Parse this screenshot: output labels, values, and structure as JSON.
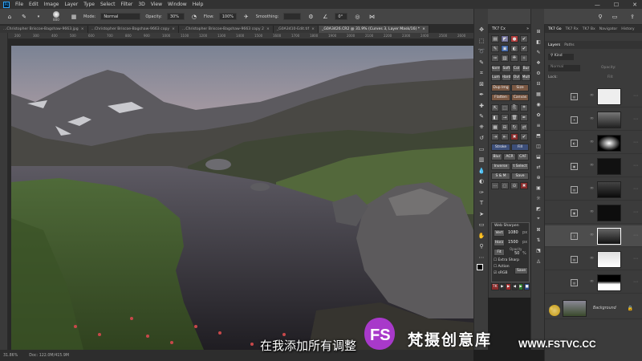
{
  "menubar": {
    "app_icon": "Ps",
    "items": [
      "File",
      "Edit",
      "Image",
      "Layer",
      "Type",
      "Select",
      "Filter",
      "3D",
      "View",
      "Window",
      "Help"
    ],
    "window_controls": [
      "minimize-icon",
      "maximize-icon",
      "close-icon"
    ]
  },
  "options_bar": {
    "mode_label": "Mode:",
    "mode_value": "Normal",
    "opacity_label": "Opacity:",
    "opacity_value": "30%",
    "flow_label": "Flow:",
    "flow_value": "100%",
    "smoothing_label": "Smoothing:",
    "brush_size": "800",
    "angle_value": "0°"
  },
  "tabs": [
    {
      "label": "...Christopher Briscoe-Bagshaw-9663.jpg",
      "active": false
    },
    {
      "label": "...Christopher Briscoe-Bagshaw-9663 copy",
      "active": false
    },
    {
      "label": "...Christopher Briscoe-Bagshaw-9663 copy 2",
      "active": false
    },
    {
      "label": "_G0A3410-Edit.tif",
      "active": false
    },
    {
      "label": "_G0A3426.CR2 @ 31.9% (Curves 3, Layer Mask/16) *",
      "active": true
    }
  ],
  "ruler_top": [
    "200",
    "300",
    "400",
    "500",
    "600",
    "700",
    "800",
    "900",
    "1000",
    "1100",
    "1200",
    "1300",
    "1400",
    "1500",
    "1600",
    "1700",
    "1800",
    "1900",
    "2000",
    "2100",
    "2200",
    "2300",
    "2400",
    "2500",
    "2600"
  ],
  "status": {
    "zoom": "31.86%",
    "doc": "Doc: 122.0M/415.9M"
  },
  "tk_panel": {
    "title": "TK7 Cx",
    "buttons": {
      "dup_img": "Dup Img",
      "size": "Size",
      "flatten": "Flatten",
      "canvas": "Canvas",
      "stroke": "Stroke",
      "fill": "Fill",
      "blur": "Blur",
      "acr": "ACR",
      "caf": "CAF",
      "inverse": "Inverse",
      "t_select": "t Select",
      "s_and_m": "S & M",
      "save": "Save",
      "norm": "Norm",
      "soft": "Soft",
      "col": "Col",
      "bur": "Bur",
      "lum": "Lum",
      "hard": "Hard",
      "ovl": "Ovl",
      "mult": "Mult"
    },
    "web_sharpen": {
      "title": "Web Sharpen",
      "vert_label": "Vert",
      "vert_value": "1080",
      "vert_unit": "px",
      "horz_label": "Horz",
      "horz_value": "1500",
      "horz_unit": "px",
      "fit_label": "Fit",
      "opacity_label": "Opacity",
      "opacity_value": "50",
      "opacity_unit": "%",
      "extra_sharp": "Extra Sharp",
      "action": "Action",
      "srgb": "sRGB",
      "save": "Save"
    },
    "bottom_tk": "TK"
  },
  "layers_panel": {
    "top_tabs": [
      "TK7 Go",
      "TK7 Rx",
      "TK7 Bx",
      "Navigator",
      "History"
    ],
    "tabs": [
      "Layers",
      "Paths"
    ],
    "kind_label": "Kind",
    "blend_mode": "Normal",
    "opacity_label": "Opacity:",
    "lock_label": "Lock:",
    "fill_label": "Fill:",
    "background_name": "Background"
  },
  "overlay": {
    "subtitle": "在我添加所有调整",
    "watermark_text": "梵摄创意库",
    "watermark_url": "WWW.FSTVC.CC",
    "logo_letters": "FS"
  },
  "colors": {
    "accent": "#31a8ff",
    "panel_bg": "#3b3b3b",
    "tk_brown": "#7a5843",
    "tk_red": "#8a2b2b",
    "logo_purple": "#b23ad8"
  }
}
